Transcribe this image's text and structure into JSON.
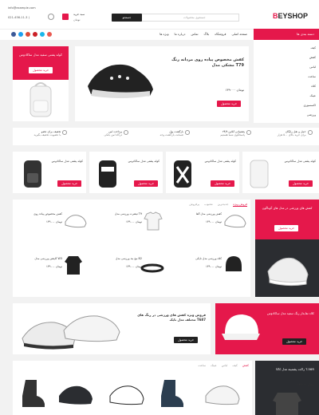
{
  "topbar": {
    "email": "info@example.com",
    "phone": "021-456-11-3 )",
    "wishlist_badge": "0",
    "cart_badge": "0",
    "cart_label": "سبد خرید",
    "cart_amount": "تومان",
    "search_btn": "جستجو",
    "search_placeholder": "جستجوی محصولات",
    "logo": "BEYSHOP"
  },
  "nav": {
    "categories": "دسته بندی ها",
    "items": [
      "صفحه اصلی",
      "فروشگاه",
      "بلاگ",
      "تماس",
      "درباره ما",
      "ویژه ها"
    ],
    "social": [
      "f",
      "t",
      "g",
      "p",
      "v",
      "i"
    ]
  },
  "sidebar": {
    "items": [
      "کیف",
      "کفش",
      "لباس",
      "ساعت",
      "کلاه",
      "عینک",
      "اکسسوری",
      "ورزشی"
    ]
  },
  "hero": {
    "left": {
      "title": "کوله پشتی سفید مدل ساکادوس",
      "btn": "خرید محصول"
    },
    "main": {
      "title": "کفش مخصوص پیاده روی مردانه رنگ مشکی مدل T79",
      "price": "۱۳۹۰۰۰ تومان",
      "btn": "خرید محصول"
    }
  },
  "features": [
    {
      "title": "حمل و نقل رایگان",
      "sub": "برای خرید بالای ۵۰۰ هزار"
    },
    {
      "title": "پشتیبانی آنلاین ۲۴/۷",
      "sub": "پاسخگوی شما هستیم"
    },
    {
      "title": "بازگشت پول",
      "sub": "ضمانت بازگشت وجه"
    },
    {
      "title": "پرداخت امن",
      "sub": "درگاه امن بانکی"
    },
    {
      "title": "تخفیف برای عضو",
      "sub": "با عضویت تخفیف بگیرید"
    }
  ],
  "promos": [
    {
      "title": "کوله پشتی مدل ساکادوس",
      "btn": "خرید محصول"
    },
    {
      "title": "کوله پشتی مدل ساکادوس",
      "btn": "خرید محصول"
    },
    {
      "title": "کوله پشتی مدل ساکادوس",
      "btn": "خرید محصول"
    },
    {
      "title": "کوله پشتی مدل ساکادوس",
      "btn": "خرید محصول"
    }
  ],
  "deal": {
    "title": "کفش های ورزشی در مدل های گوناگون",
    "btn": "خرید محصول"
  },
  "tabs": [
    "فروش ویژه",
    "جدیدترین",
    "محبوب",
    "پرفروش"
  ],
  "products": [
    {
      "name": "کفش مخصوص پیاده روی",
      "price": "۱۳۹۰۰۰ تومان"
    },
    {
      "name": "تیشرت ورزشی مدل T9",
      "price": "۱۳۹۰۰۰ تومان"
    },
    {
      "name": "کفش ورزشی مدل آلفا",
      "price": "۱۳۹۰۰۰ تومان"
    },
    {
      "name": "کلاه ورزشی مدل نایکی",
      "price": "۱۳۹۰۰۰ تومان"
    },
    {
      "name": "مچ بند ورزشی مدل B2",
      "price": "۱۳۹۰۰۰ تومان"
    },
    {
      "name": "کاپشن ورزشی مدل W3",
      "price": "۱۳۹۰۰۰ تومان"
    }
  ],
  "banner": {
    "title": "فروش ویژه کفش های ورزشی در رنگ های مختلف مدل نایک T687",
    "btn": "خرید محصول"
  },
  "cap_banner": {
    "title": "کلاه نقابدار رنگ سفید مدل ساکادوس",
    "btn": "خرید محصول"
  },
  "bottom_tabs": [
    "کفش",
    "کیف",
    "لباس",
    "عینک",
    "ساعت"
  ],
  "bottom_banner": {
    "title": "زاکت پشمینه مدل کاکا T-56R",
    "price": "۱۳۹۰۰۰ تومان"
  }
}
